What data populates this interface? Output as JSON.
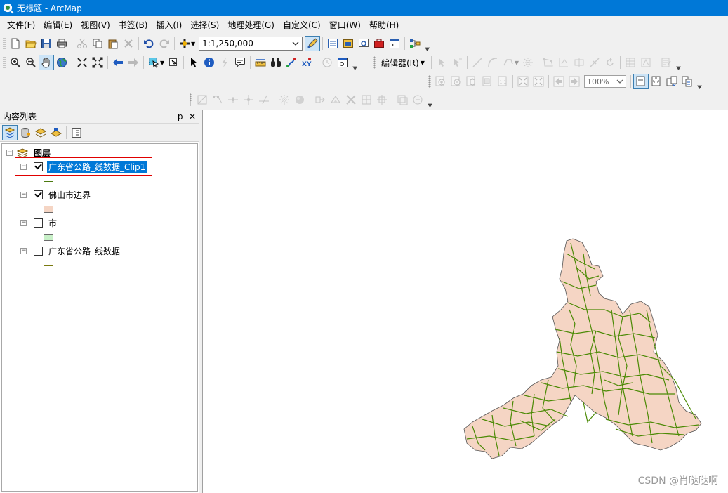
{
  "window": {
    "title": "无标题 - ArcMap"
  },
  "menu": [
    "文件(F)",
    "编辑(E)",
    "视图(V)",
    "书签(B)",
    "插入(I)",
    "选择(S)",
    "地理处理(G)",
    "自定义(C)",
    "窗口(W)",
    "帮助(H)"
  ],
  "standard_toolbar": {
    "scale_value": "1:1,250,000"
  },
  "editor_toolbar": {
    "label": "编辑器(R)"
  },
  "layout_toolbar": {
    "zoom_value": "100%"
  },
  "toc": {
    "title": "内容列表",
    "pin_glyph": "ᵽ",
    "close_glyph": "✕",
    "root_label": "图层",
    "layers": [
      {
        "name": "广东省公路_线数据_Clip1",
        "checked": true,
        "selected": true,
        "symbol": "line",
        "color": "#4c7a0f"
      },
      {
        "name": "佛山市边界",
        "checked": true,
        "selected": false,
        "symbol": "polygon",
        "color": "#f5d5c4"
      },
      {
        "name": "市",
        "checked": false,
        "selected": false,
        "symbol": "polygon",
        "color": "#c8f0c8"
      },
      {
        "name": "广东省公路_线数据",
        "checked": false,
        "selected": false,
        "symbol": "line",
        "color": "#7a7a10"
      }
    ]
  },
  "map": {
    "polygon_fill": "#f5d5c4",
    "road_color": "#4b8a05",
    "watermark": "CSDN @肖哒哒啊"
  }
}
